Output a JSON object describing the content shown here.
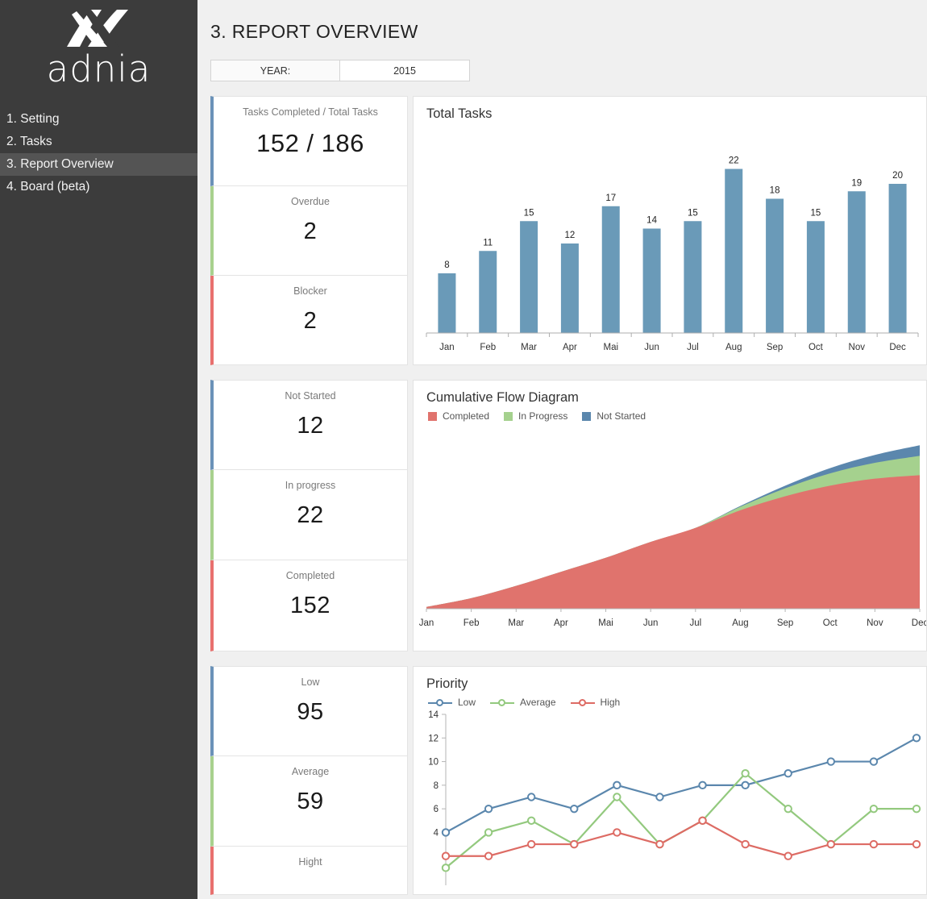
{
  "sidebar": {
    "logo_text": "adnia",
    "logo_icon": "adnia-logo-icon",
    "items": [
      {
        "label": "1. Setting",
        "active": false
      },
      {
        "label": "2. Tasks",
        "active": false
      },
      {
        "label": "3. Report Overview",
        "active": true
      },
      {
        "label": "4. Board (beta)",
        "active": false
      }
    ]
  },
  "header": {
    "title": "3. REPORT OVERVIEW",
    "year_label": "YEAR:",
    "year_value": "2015"
  },
  "kpis_row1": [
    {
      "label": "Tasks Completed / Total Tasks",
      "value": "152 / 186",
      "accent": "#6b92b8"
    },
    {
      "label": "Overdue",
      "value": "2",
      "accent": "#a8d18e"
    },
    {
      "label": "Blocker",
      "value": "2",
      "accent": "#e8706e"
    }
  ],
  "kpis_row2": [
    {
      "label": "Not Started",
      "value": "12",
      "accent": "#6b92b8"
    },
    {
      "label": "In progress",
      "value": "22",
      "accent": "#a8d18e"
    },
    {
      "label": "Completed",
      "value": "152",
      "accent": "#e8706e"
    }
  ],
  "kpis_row3": [
    {
      "label": "Low",
      "value": "95",
      "accent": "#6b92b8"
    },
    {
      "label": "Average",
      "value": "59",
      "accent": "#a8d18e"
    },
    {
      "label": "Hight",
      "value": "",
      "accent": "#e8706e"
    }
  ],
  "colors": {
    "bar_blue": "#6a9ab8",
    "area_completed": "#e0736d",
    "area_inprogress": "#a5d18e",
    "area_notstarted": "#5b87ad",
    "line_low": "#5b87ad",
    "line_average": "#93c97e",
    "line_high": "#dd6b64",
    "sidebar_bg": "#3c3c3c",
    "sidebar_active": "#545454",
    "page_bg": "#f0f0f0"
  },
  "chart_data": [
    {
      "type": "bar",
      "title": "Total Tasks",
      "categories": [
        "Jan",
        "Feb",
        "Mar",
        "Apr",
        "Mai",
        "Jun",
        "Jul",
        "Aug",
        "Sep",
        "Oct",
        "Nov",
        "Dec"
      ],
      "values": [
        8,
        11,
        15,
        12,
        17,
        14,
        15,
        22,
        18,
        15,
        19,
        20
      ],
      "xlabel": "",
      "ylabel": "",
      "ylim": [
        0,
        24
      ],
      "data_labels": true,
      "grid": false,
      "legend": "none",
      "series_color": "#6a9ab8"
    },
    {
      "type": "area",
      "title": "Cumulative Flow Diagram",
      "stacked": true,
      "categories": [
        "Jan",
        "Feb",
        "Mar",
        "Apr",
        "Mai",
        "Jun",
        "Jul",
        "Aug",
        "Sep",
        "Oct",
        "Nov",
        "Dec"
      ],
      "series": [
        {
          "name": "Completed",
          "color": "#e0736d",
          "values": [
            2,
            12,
            26,
            42,
            58,
            76,
            92,
            112,
            128,
            140,
            148,
            152
          ]
        },
        {
          "name": "In Progress",
          "color": "#a5d18e",
          "values": [
            0,
            0,
            0,
            0,
            0,
            0,
            0,
            4,
            9,
            14,
            18,
            22
          ]
        },
        {
          "name": "Not Started",
          "color": "#5b87ad",
          "values": [
            0,
            0,
            0,
            0,
            0,
            0,
            0,
            1,
            3,
            6,
            9,
            12
          ]
        }
      ],
      "ylim": [
        0,
        200
      ],
      "grid": false,
      "legend": "top-left"
    },
    {
      "type": "line",
      "title": "Priority",
      "categories": [
        "Jan",
        "Feb",
        "Mar",
        "Apr",
        "Mai",
        "Jun",
        "Jul",
        "Aug",
        "Sep",
        "Oct",
        "Nov",
        "Dec"
      ],
      "series": [
        {
          "name": "Low",
          "color": "#5b87ad",
          "values": [
            4,
            6,
            7,
            6,
            8,
            7,
            8,
            8,
            9,
            10,
            10,
            12
          ]
        },
        {
          "name": "Average",
          "color": "#93c97e",
          "values": [
            1,
            4,
            5,
            3,
            7,
            3,
            5,
            9,
            6,
            3,
            6,
            6
          ]
        },
        {
          "name": "High",
          "color": "#dd6b64",
          "values": [
            2,
            2,
            3,
            3,
            4,
            3,
            5,
            3,
            2,
            3,
            3,
            3
          ]
        }
      ],
      "yticks": [
        14,
        12,
        10,
        8,
        6,
        4
      ],
      "ylim": [
        0,
        14
      ],
      "grid": false,
      "legend": "top-left",
      "markers": "circle-open"
    }
  ]
}
